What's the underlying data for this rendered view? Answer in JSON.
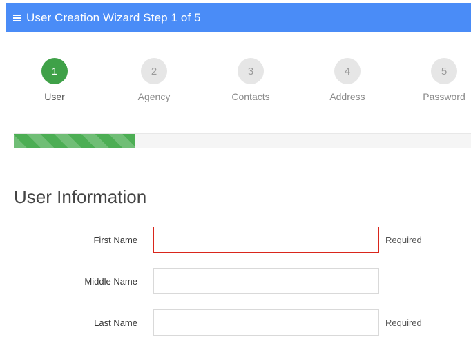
{
  "header": {
    "menu_icon": "hamburger-menu-icon",
    "title": "User Creation Wizard Step 1 of 5",
    "color": "#4a8cf7"
  },
  "steps": [
    {
      "number": "1",
      "label": "User",
      "state": "active"
    },
    {
      "number": "2",
      "label": "Agency",
      "state": "pending"
    },
    {
      "number": "3",
      "label": "Contacts",
      "state": "pending"
    },
    {
      "number": "4",
      "label": "Address",
      "state": "pending"
    },
    {
      "number": "5",
      "label": "Password",
      "state": "pending"
    }
  ],
  "progress": {
    "fraction": 0.2637,
    "color": "#4cae54"
  },
  "section": {
    "title": "User Information"
  },
  "form": {
    "first_name": {
      "label": "First Name",
      "value": "",
      "hint": "Required",
      "invalid": true
    },
    "middle_name": {
      "label": "Middle Name",
      "value": "",
      "hint": ""
    },
    "last_name": {
      "label": "Last Name",
      "value": "",
      "hint": "Required"
    }
  },
  "colors": {
    "active_step": "#3fa148",
    "inactive_step": "#e6e6e6",
    "invalid_border": "#d9261c"
  }
}
